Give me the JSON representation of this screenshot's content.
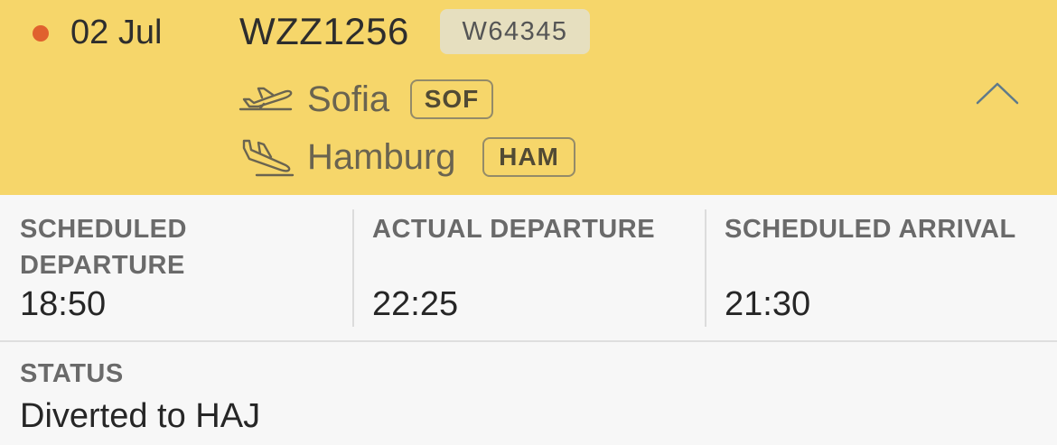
{
  "flight": {
    "date": "02 Jul",
    "number": "WZZ1256",
    "registration": "W64345",
    "status_dot_color": "#e0612e",
    "header_color": "#f6d66a",
    "departure": {
      "city": "Sofia",
      "code": "SOF",
      "icon": "takeoff-icon"
    },
    "arrival": {
      "city": "Hamburg",
      "code": "HAM",
      "icon": "landing-icon"
    },
    "collapse_icon": "chevron-up-icon"
  },
  "times": {
    "scheduled_departure": {
      "label": "SCHEDULED DEPARTURE",
      "value": "18:50"
    },
    "actual_departure": {
      "label": "ACTUAL DEPARTURE",
      "value": "22:25"
    },
    "scheduled_arrival": {
      "label": "SCHEDULED ARRIVAL",
      "value": "21:30"
    }
  },
  "status": {
    "label": "STATUS",
    "value": "Diverted to HAJ"
  }
}
